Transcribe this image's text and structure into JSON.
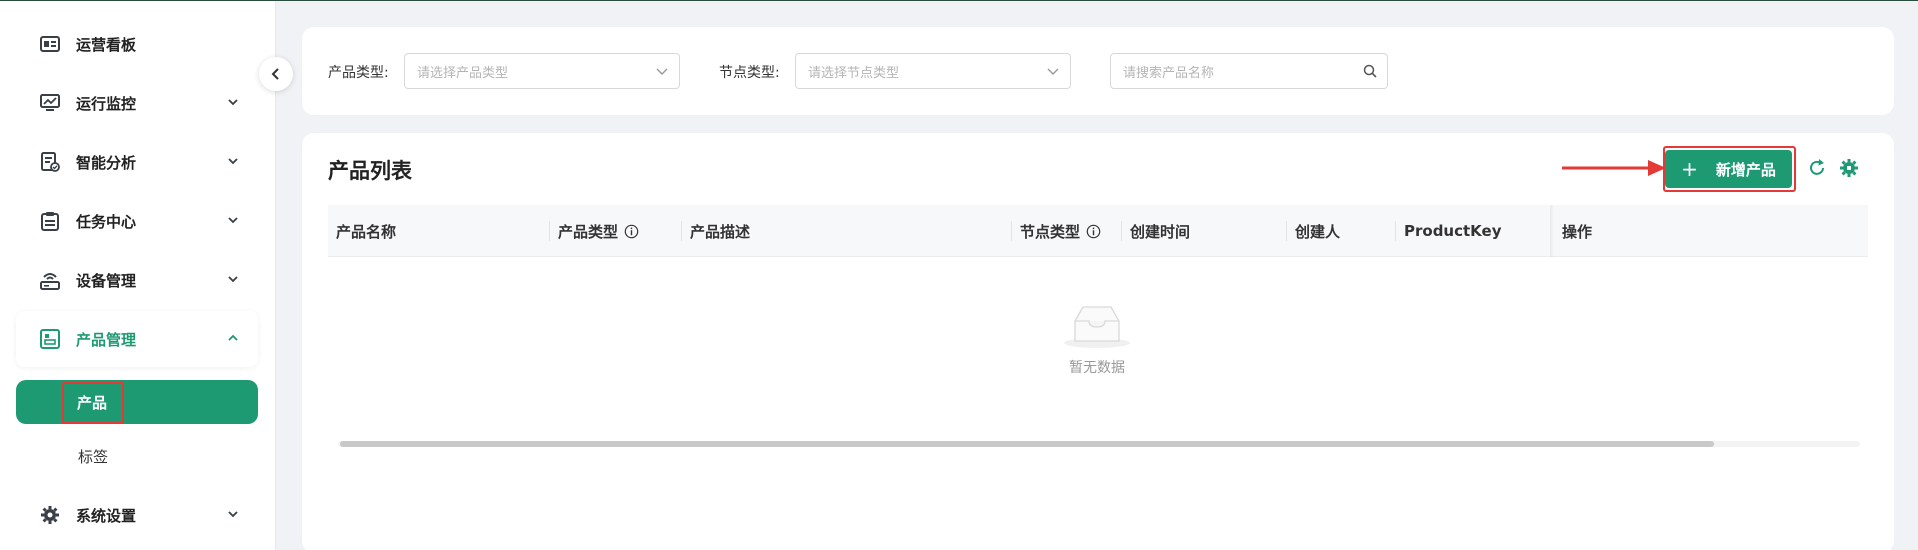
{
  "sidebar": {
    "items": [
      {
        "label": "运营看板",
        "icon": "dashboard-icon"
      },
      {
        "label": "运行监控",
        "icon": "monitor-icon"
      },
      {
        "label": "智能分析",
        "icon": "analysis-icon"
      },
      {
        "label": "任务中心",
        "icon": "clipboard-icon"
      },
      {
        "label": "设备管理",
        "icon": "router-icon"
      },
      {
        "label": "产品管理",
        "icon": "product-icon"
      },
      {
        "label": "系统设置",
        "icon": "gear-icon"
      }
    ],
    "sub_items": [
      {
        "label": "产品"
      },
      {
        "label": "标签"
      }
    ]
  },
  "filters": {
    "product_type_label": "产品类型:",
    "product_type_placeholder": "请选择产品类型",
    "node_type_label": "节点类型:",
    "node_type_placeholder": "请选择节点类型",
    "search_placeholder": "请搜索产品名称"
  },
  "list": {
    "title": "产品列表",
    "add_button": "新增产品",
    "columns": [
      "产品名称",
      "产品类型",
      "产品描述",
      "节点类型",
      "创建时间",
      "创建人",
      "ProductKey",
      "操作"
    ],
    "empty_text": "暂无数据"
  },
  "colors": {
    "accent": "#1e9a72",
    "highlight": "#e53935"
  }
}
